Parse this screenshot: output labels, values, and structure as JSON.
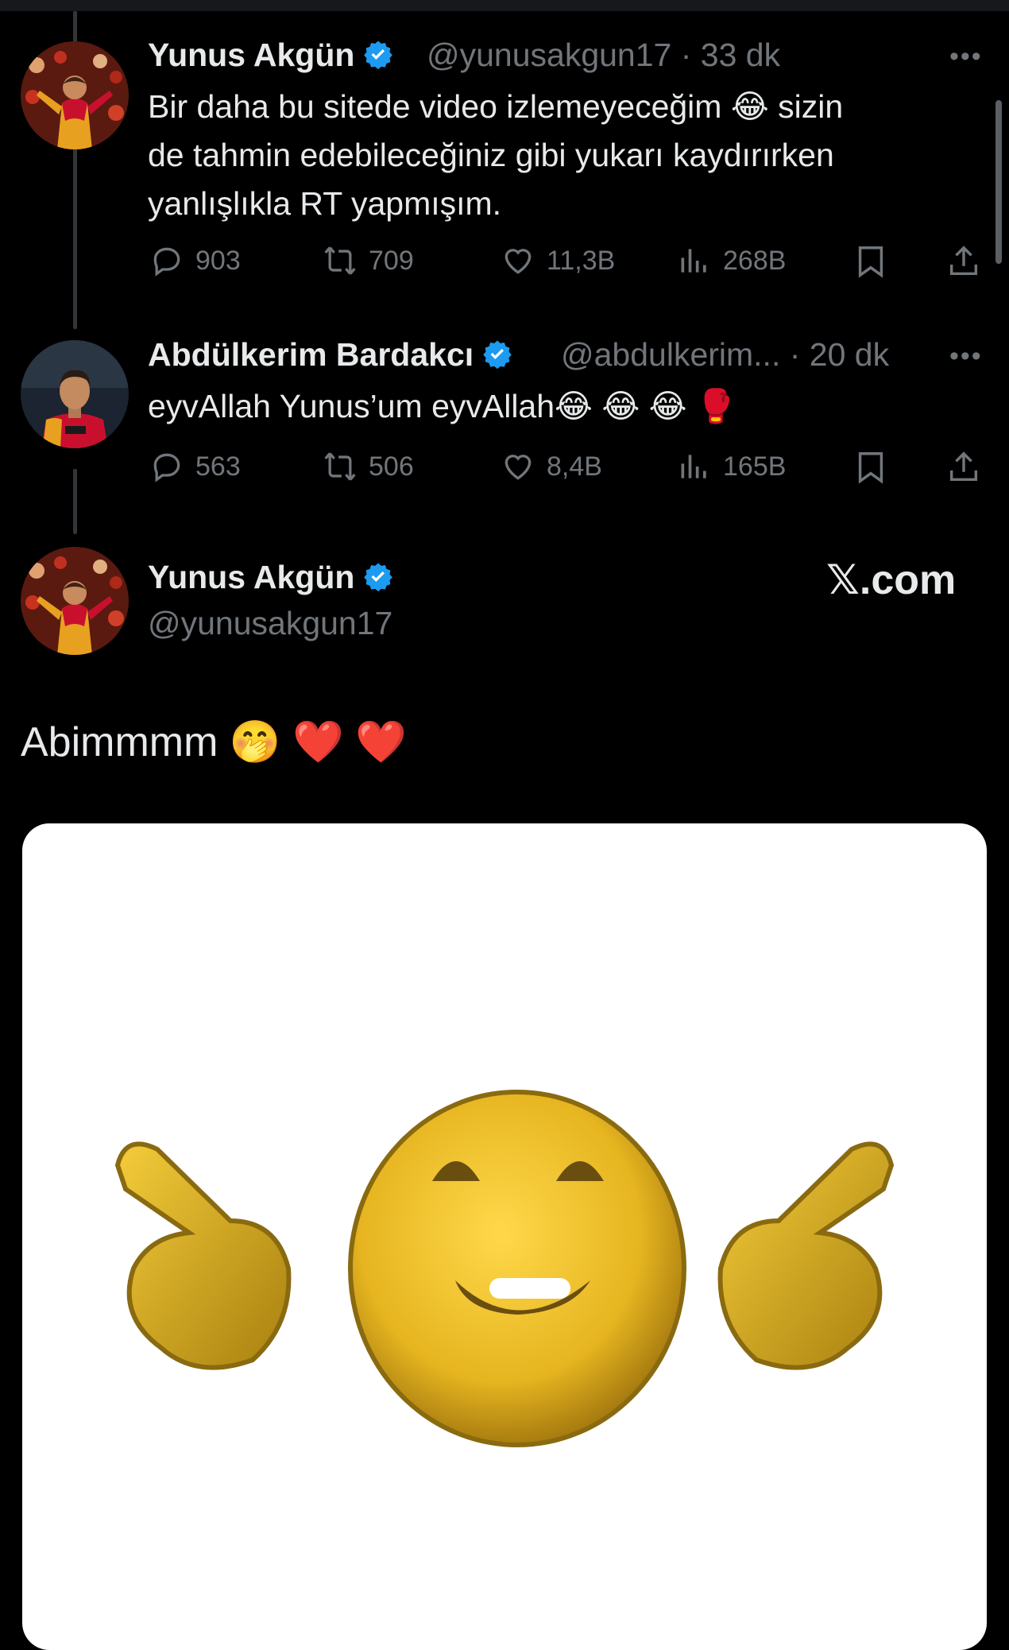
{
  "tweets": [
    {
      "name": "Yunus Akgün",
      "handle": "@yunusakgun17",
      "time": "· 33 dk",
      "lines": [
        "Bir daha bu sitede video izlemeyeceğim 😂  sizin",
        "de tahmin edebileceğiniz gibi yukarı kaydırırken",
        "yanlışlıkla RT yapmışım."
      ],
      "replies": "903",
      "retweets": "709",
      "likes": "11,3B",
      "views": "268B"
    },
    {
      "name": "Abdülkerim Bardakcı",
      "handle": "@abdulkerim...",
      "time": "· 20 dk",
      "lines": [
        "eyvAllah Yunus’um eyvAllah😂 😂 😂 🥊"
      ],
      "replies": "563",
      "retweets": "506",
      "likes": "8,4B",
      "views": "165B"
    }
  ],
  "main_post": {
    "name": "Yunus Akgün",
    "handle": "@yunusakgun17",
    "brand": "𝕏.com",
    "text": "Abimmmm 🤭 ❤️ ❤️"
  },
  "colors": {
    "background": "#000000",
    "text": "#e7e9ea",
    "muted": "#71767b",
    "verified": "#1d9bf0",
    "media_bg": "#ffffff"
  },
  "icons": [
    "reply-icon",
    "retweet-icon",
    "like-icon",
    "views-icon",
    "bookmark-icon",
    "share-icon",
    "more-icon",
    "verified-badge-icon"
  ]
}
